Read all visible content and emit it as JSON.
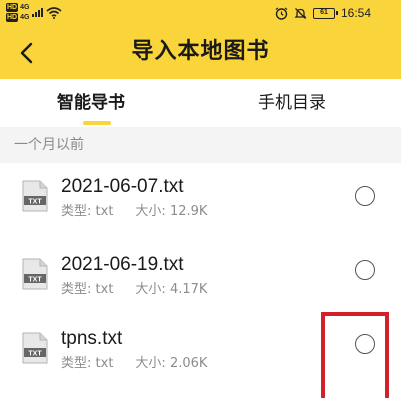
{
  "status_bar": {
    "sim1_label": "HD",
    "sim1_network": "4G",
    "sim2_label": "HD",
    "sim2_network": "4G",
    "battery": "61",
    "time": "16:54",
    "icons": [
      "signal-icon",
      "wifi-icon",
      "alarm-icon",
      "mute-icon",
      "battery-icon"
    ]
  },
  "header": {
    "title": "导入本地图书",
    "background": "#f9d43a"
  },
  "tabs": [
    {
      "label": "智能导书",
      "active": true
    },
    {
      "label": "手机目录",
      "active": false
    }
  ],
  "section": {
    "label": "一个月以前"
  },
  "files": [
    {
      "name": "2021-06-07.txt",
      "type_label": "类型:",
      "type": "txt",
      "size_label": "大小:",
      "size": "12.9K",
      "icon_text": "TXT",
      "selected": false
    },
    {
      "name": "2021-06-19.txt",
      "type_label": "类型:",
      "type": "txt",
      "size_label": "大小:",
      "size": "4.17K",
      "icon_text": "TXT",
      "selected": false
    },
    {
      "name": "tpns.txt",
      "type_label": "类型:",
      "type": "txt",
      "size_label": "大小:",
      "size": "2.06K",
      "icon_text": "TXT",
      "selected": false
    }
  ],
  "colors": {
    "accent": "#f9d43a",
    "highlight": "#d4202a"
  }
}
